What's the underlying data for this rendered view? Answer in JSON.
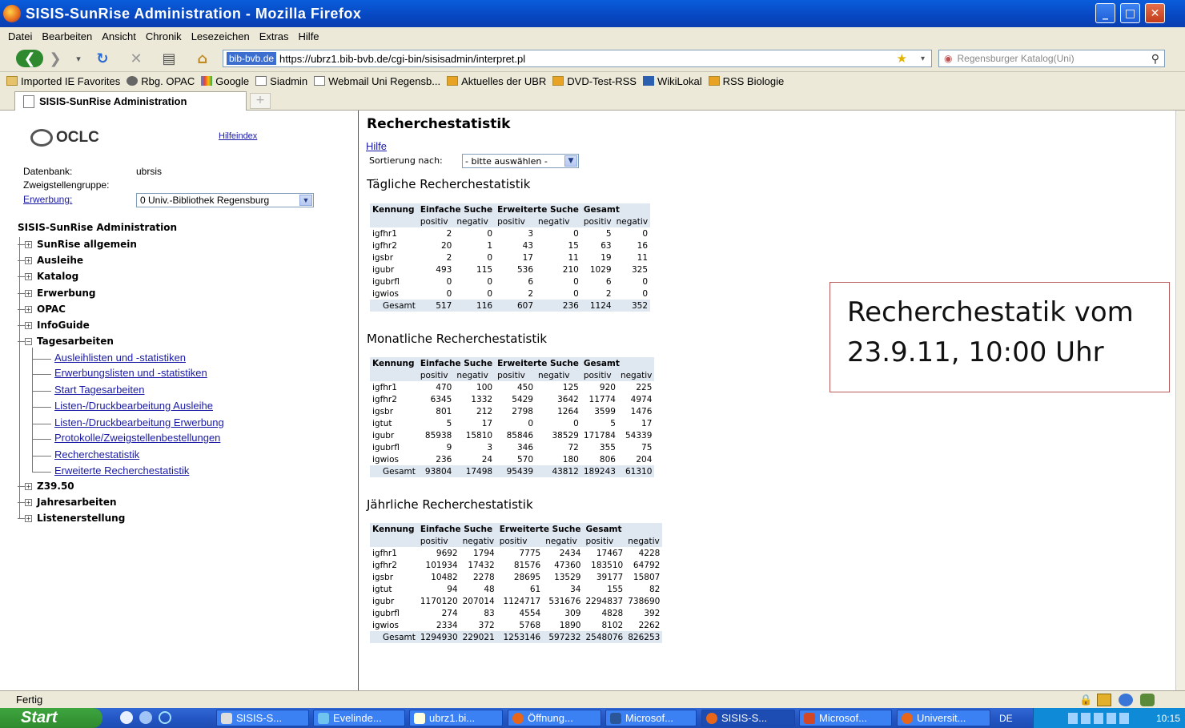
{
  "window": {
    "title": "SISIS-SunRise Administration - Mozilla Firefox"
  },
  "menu": [
    "Datei",
    "Bearbeiten",
    "Ansicht",
    "Chronik",
    "Lesezeichen",
    "Extras",
    "Hilfe"
  ],
  "nav": {
    "site_badge": "bib-bvb.de",
    "url": "https://ubrz1.bib-bvb.de/cgi-bin/sisisadmin/interpret.pl",
    "search_placeholder": "Regensburger Katalog(Uni)"
  },
  "bookmarks": [
    "Imported IE Favorites",
    "Rbg. OPAC",
    "Google",
    "Siadmin",
    "Webmail Uni Regensb...",
    "Aktuelles der UBR",
    "DVD-Test-RSS",
    "WikiLokal",
    "RSS Biologie"
  ],
  "tab": {
    "label": "SISIS-SunRise Administration",
    "new_tab": "+"
  },
  "left": {
    "logo": "OCLC",
    "hilfeindex": "Hilfeindex",
    "db_label": "Datenbank:",
    "db_value": "ubrsis",
    "zweig_label": "Zweigstellengruppe:",
    "erwerbung_label": "Erwerbung:",
    "branch_value": "0 Univ.-Bibliothek Regensburg",
    "admin_title": "SISIS-SunRise Administration",
    "tree": [
      "SunRise allgemein",
      "Ausleihe",
      "Katalog",
      "Erwerbung",
      "OPAC",
      "InfoGuide",
      "Tagesarbeiten",
      "Z39.50",
      "Jahresarbeiten",
      "Listenerstellung"
    ],
    "sub": [
      "Ausleihlisten und -statistiken",
      "Erwerbungslisten und -statistiken",
      "Start Tagesarbeiten",
      "Listen-/Druckbearbeitung Ausleihe",
      "Listen-/Druckbearbeitung Erwerbung",
      "Protokolle/Zweigstellenbestellungen",
      "Recherchestatistik",
      "Erweiterte Recherchestatistik"
    ]
  },
  "main": {
    "title": "Recherchestatistik",
    "help": "Hilfe",
    "sort_label": "Sortierung nach:",
    "sort_value": "- bitte auswählen -",
    "daily_title": "Tägliche Recherchestatistik",
    "monthly_title": "Monatliche Recherchestatistik",
    "yearly_title": "Jährliche Recherchestatistik",
    "headers": [
      "Kennung",
      "Einfache Suche",
      "Erweiterte Suche",
      "Gesamt"
    ],
    "subheaders": [
      "positiv",
      "negativ",
      "positiv",
      "negativ",
      "positiv",
      "negativ"
    ],
    "daily": [
      [
        "igfhr1",
        "2",
        "0",
        "3",
        "0",
        "5",
        "0"
      ],
      [
        "igfhr2",
        "20",
        "1",
        "43",
        "15",
        "63",
        "16"
      ],
      [
        "igsbr",
        "2",
        "0",
        "17",
        "11",
        "19",
        "11"
      ],
      [
        "igubr",
        "493",
        "115",
        "536",
        "210",
        "1029",
        "325"
      ],
      [
        "igubrfl",
        "0",
        "0",
        "6",
        "0",
        "6",
        "0"
      ],
      [
        "igwios",
        "0",
        "0",
        "2",
        "0",
        "2",
        "0"
      ],
      [
        "Gesamt",
        "517",
        "116",
        "607",
        "236",
        "1124",
        "352"
      ]
    ],
    "monthly": [
      [
        "igfhr1",
        "470",
        "100",
        "450",
        "125",
        "920",
        "225"
      ],
      [
        "igfhr2",
        "6345",
        "1332",
        "5429",
        "3642",
        "11774",
        "4974"
      ],
      [
        "igsbr",
        "801",
        "212",
        "2798",
        "1264",
        "3599",
        "1476"
      ],
      [
        "igtut",
        "5",
        "17",
        "0",
        "0",
        "5",
        "17"
      ],
      [
        "igubr",
        "85938",
        "15810",
        "85846",
        "38529",
        "171784",
        "54339"
      ],
      [
        "igubrfl",
        "9",
        "3",
        "346",
        "72",
        "355",
        "75"
      ],
      [
        "igwios",
        "236",
        "24",
        "570",
        "180",
        "806",
        "204"
      ],
      [
        "Gesamt",
        "93804",
        "17498",
        "95439",
        "43812",
        "189243",
        "61310"
      ]
    ],
    "yearly": [
      [
        "igfhr1",
        "9692",
        "1794",
        "7775",
        "2434",
        "17467",
        "4228"
      ],
      [
        "igfhr2",
        "101934",
        "17432",
        "81576",
        "47360",
        "183510",
        "64792"
      ],
      [
        "igsbr",
        "10482",
        "2278",
        "28695",
        "13529",
        "39177",
        "15807"
      ],
      [
        "igtut",
        "94",
        "48",
        "61",
        "34",
        "155",
        "82"
      ],
      [
        "igubr",
        "1170120",
        "207014",
        "1124717",
        "531676",
        "2294837",
        "738690"
      ],
      [
        "igubrfl",
        "274",
        "83",
        "4554",
        "309",
        "4828",
        "392"
      ],
      [
        "igwios",
        "2334",
        "372",
        "5768",
        "1890",
        "8102",
        "2262"
      ],
      [
        "Gesamt",
        "1294930",
        "229021",
        "1253146",
        "597232",
        "2548076",
        "826253"
      ]
    ],
    "note_line1": "Recherchestatik vom",
    "note_line2": "23.9.11, 10:00 Uhr"
  },
  "status": "Fertig",
  "taskbar": {
    "start": "Start",
    "items": [
      "SISIS-S...",
      "Evelinde...",
      "ubrz1.bi...",
      "Öffnung...",
      "Microsof...",
      "SISIS-S...",
      "Microsof...",
      "Universit..."
    ],
    "lang": "DE",
    "clock": "10:15"
  }
}
